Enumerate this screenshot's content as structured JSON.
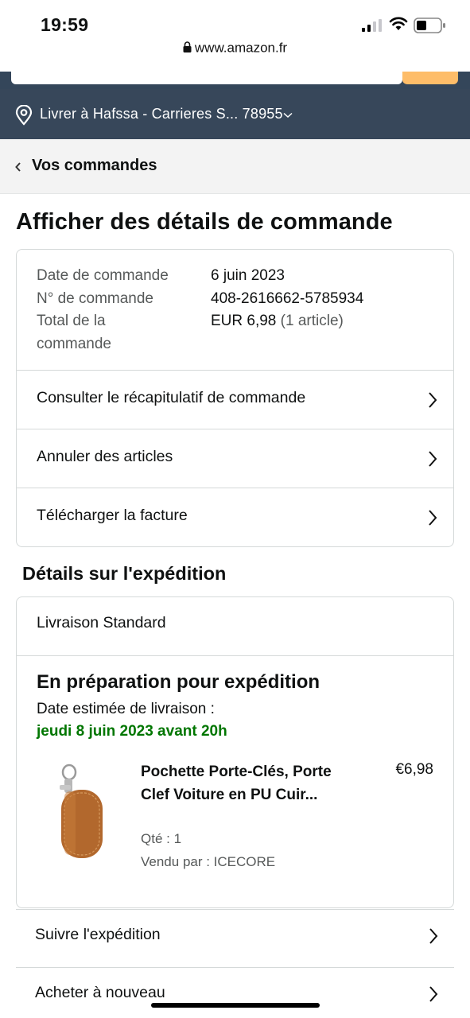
{
  "status_bar": {
    "time": "19:59",
    "url": "www.amazon.fr"
  },
  "header": {
    "deliver_to": "Livrer à Hafssa - Carrieres S... 78955"
  },
  "breadcrumb": {
    "label": "Vos commandes"
  },
  "page_title": "Afficher des détails de commande",
  "order_summary": {
    "date_label": "Date de commande",
    "date_value": "6 juin 2023",
    "number_label": "N° de commande",
    "number_value": "408-2616662-5785934",
    "total_label": "Total de la commande",
    "total_value": "EUR 6,98",
    "total_count": "(1 article)"
  },
  "actions": [
    {
      "label": "Consulter le récapitulatif de commande"
    },
    {
      "label": "Annuler des articles"
    },
    {
      "label": "Télécharger la facture"
    }
  ],
  "shipment": {
    "section_title": "Détails sur l'expédition",
    "method": "Livraison Standard",
    "status": "En préparation pour expédition",
    "estimated_label": "Date estimée de livraison :",
    "estimated_date": "jeudi 8 juin 2023 avant 20h",
    "item": {
      "name": "Pochette Porte-Clés, Porte Clef Voiture en PU Cuir...",
      "price": "€6,98",
      "quantity": "Qté : 1",
      "seller": "Vendu par : ICECORE"
    }
  },
  "shipment_actions": [
    {
      "label": "Suivre l'expédition"
    },
    {
      "label": "Acheter à nouveau"
    }
  ],
  "colors": {
    "header_bg": "#37475a",
    "accent_orange": "#febd69",
    "delivery_green": "#007600",
    "border": "#d5d9d9"
  }
}
